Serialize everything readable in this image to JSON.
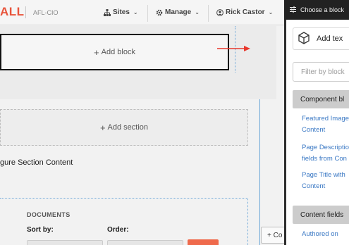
{
  "topbar": {
    "brand": "ALL",
    "org": "AFL-CIO",
    "nav": [
      {
        "label": "Sites",
        "icon": "sitemap-icon"
      },
      {
        "label": "Manage",
        "icon": "gear-icon"
      },
      {
        "label": "Rick Castor",
        "icon": "user-icon"
      }
    ]
  },
  "layout_builder": {
    "add_block_label": "Add block",
    "add_section_label": "Add section",
    "configure_text": "gure Section Content",
    "documents": {
      "title": "DOCUMENTS",
      "sort_label": "Sort by:",
      "order_label": "Order:"
    },
    "content_button_label": "+ Co"
  },
  "sidebar": {
    "title": "Choose a block",
    "add_text_label": "Add tex",
    "filter_placeholder": "Filter by block",
    "categories": [
      {
        "label": "Component bl",
        "items": [
          [
            "Featured Image",
            "Content"
          ],
          [
            "Page Descriptio",
            "fields from Con"
          ],
          [
            "Page Title with",
            "Content"
          ]
        ]
      },
      {
        "label": "Content fields",
        "items": [
          [
            "Authored on"
          ]
        ]
      }
    ]
  },
  "colors": {
    "brand": "#e8533a",
    "arrow": "#e8372c",
    "link": "#3a78c4",
    "sidebar_bg": "#2d2d2d",
    "apply_button": "#ef6a4c"
  }
}
